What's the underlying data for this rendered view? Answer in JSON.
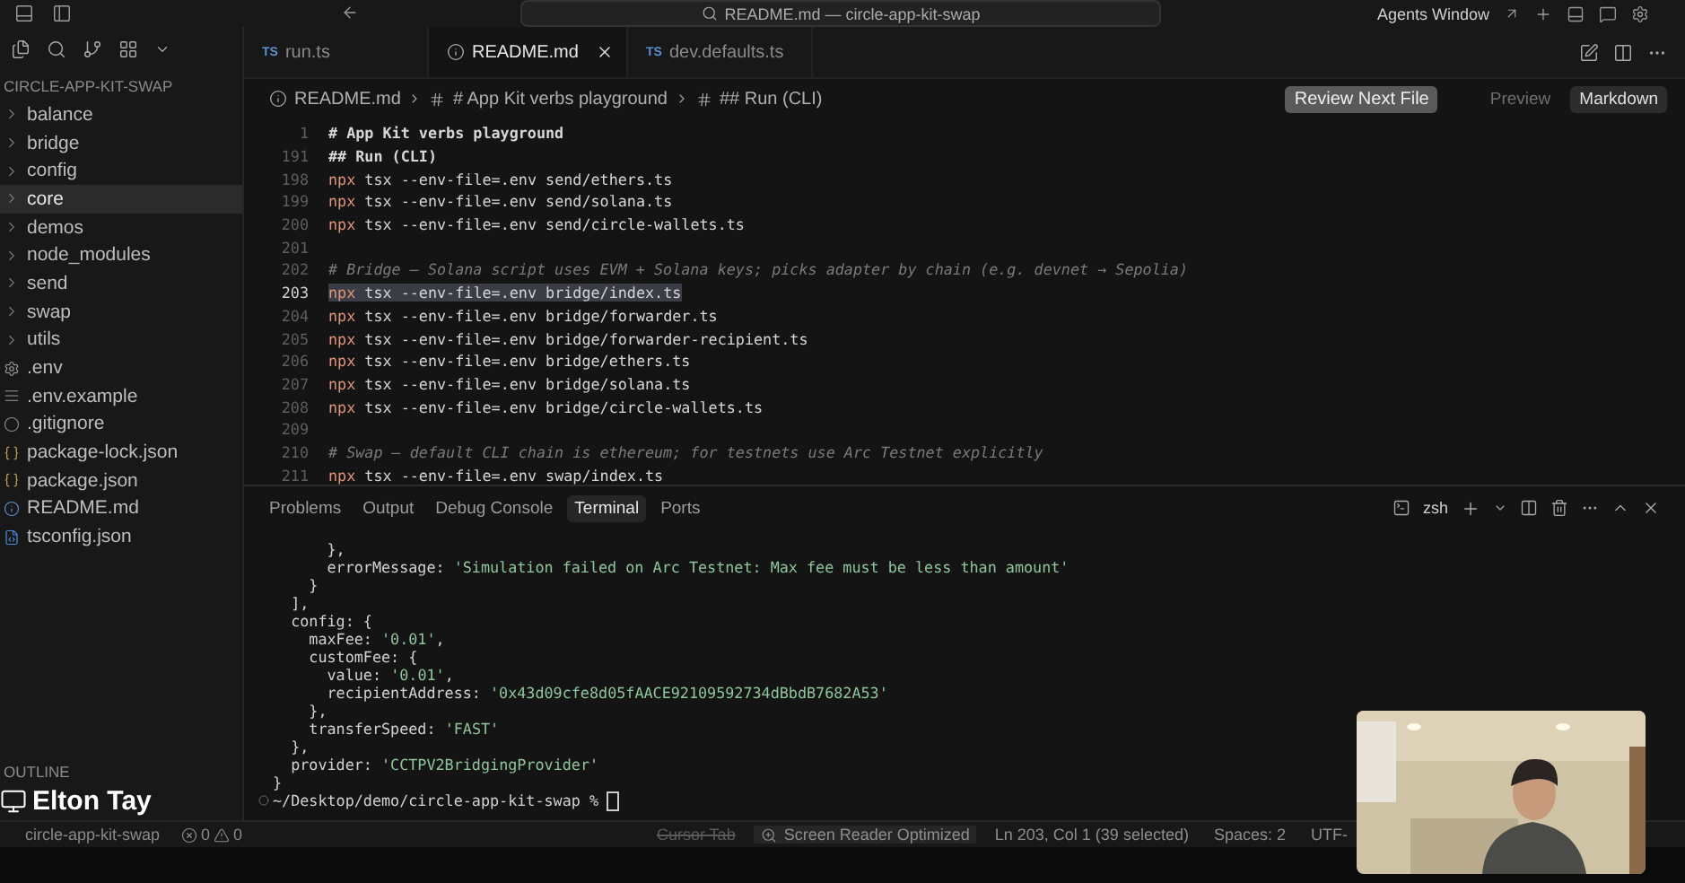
{
  "title_bar": {
    "command_center": "README.md — circle-app-kit-swap",
    "agents_window": "Agents Window"
  },
  "sidebar": {
    "title": "CIRCLE-APP-KIT-SWAP",
    "items": [
      {
        "label": "balance",
        "kind": "folder",
        "selected": false
      },
      {
        "label": "bridge",
        "kind": "folder",
        "selected": false
      },
      {
        "label": "config",
        "kind": "folder",
        "selected": false
      },
      {
        "label": "core",
        "kind": "folder",
        "selected": true
      },
      {
        "label": "demos",
        "kind": "folder",
        "selected": false
      },
      {
        "label": "node_modules",
        "kind": "folder",
        "selected": false
      },
      {
        "label": "send",
        "kind": "folder",
        "selected": false
      },
      {
        "label": "swap",
        "kind": "folder",
        "selected": false
      },
      {
        "label": "utils",
        "kind": "folder",
        "selected": false
      },
      {
        "label": ".env",
        "kind": "env",
        "selected": false
      },
      {
        "label": ".env.example",
        "kind": "text",
        "selected": false
      },
      {
        "label": ".gitignore",
        "kind": "git",
        "selected": false
      },
      {
        "label": "package-lock.json",
        "kind": "json",
        "selected": false
      },
      {
        "label": "package.json",
        "kind": "json",
        "selected": false
      },
      {
        "label": "README.md",
        "kind": "info",
        "selected": false
      },
      {
        "label": "tsconfig.json",
        "kind": "ts",
        "selected": false
      }
    ],
    "outline": "OUTLINE"
  },
  "editor_tabs": [
    {
      "label": "run.ts",
      "kind": "ts",
      "badge": "TS",
      "selected": false
    },
    {
      "label": "README.md",
      "kind": "markdown",
      "selected": true
    },
    {
      "label": "dev.defaults.ts",
      "kind": "ts",
      "badge": "TS",
      "selected": false
    }
  ],
  "breadcrumb": [
    "README.md",
    "# App Kit verbs playground",
    "## Run (CLI)"
  ],
  "review_button": "Review Next File",
  "view_modes": [
    {
      "label": "Preview",
      "selected": false
    },
    {
      "label": "Markdown",
      "selected": true
    }
  ],
  "code_lines": [
    {
      "number": "1",
      "kind": "heading",
      "code": "# App Kit verbs playground",
      "selected": false
    },
    {
      "number": "191",
      "kind": "heading",
      "code": "## Run (CLI)",
      "selected": false
    },
    {
      "number": "198",
      "kind": "command",
      "code": "npx tsx --env-file=.env send/ethers.ts",
      "selected": false
    },
    {
      "number": "199",
      "kind": "command",
      "code": "npx tsx --env-file=.env send/solana.ts",
      "selected": false
    },
    {
      "number": "200",
      "kind": "command",
      "code": "npx tsx --env-file=.env send/circle-wallets.ts",
      "selected": false
    },
    {
      "number": "201",
      "kind": "blank",
      "selected": false
    },
    {
      "number": "202",
      "kind": "comment",
      "code": "# Bridge — Solana script uses EVM + Solana keys; picks adapter by chain (e.g. devnet → Sepolia)",
      "selected": false
    },
    {
      "number": "203",
      "kind": "command",
      "code": "npx tsx --env-file=.env bridge/index.ts",
      "selected": true
    },
    {
      "number": "204",
      "kind": "command",
      "code": "npx tsx --env-file=.env bridge/forwarder.ts",
      "selected": false
    },
    {
      "number": "205",
      "kind": "command",
      "code": "npx tsx --env-file=.env bridge/forwarder-recipient.ts",
      "selected": false
    },
    {
      "number": "206",
      "kind": "command",
      "code": "npx tsx --env-file=.env bridge/ethers.ts",
      "selected": false
    },
    {
      "number": "207",
      "kind": "command",
      "code": "npx tsx --env-file=.env bridge/solana.ts",
      "selected": false
    },
    {
      "number": "208",
      "kind": "command",
      "code": "npx tsx --env-file=.env bridge/circle-wallets.ts",
      "selected": false
    },
    {
      "number": "209",
      "kind": "blank",
      "selected": false
    },
    {
      "number": "210",
      "kind": "comment",
      "code": "# Swap — default CLI chain is ethereum; for testnets use Arc Testnet explicitly",
      "selected": false
    },
    {
      "number": "211",
      "kind": "command",
      "code": "npx tsx --env-file=.env swap/index.ts",
      "selected": false
    }
  ],
  "panel_tabs": [
    {
      "label": "Problems",
      "selected": false
    },
    {
      "label": "Output",
      "selected": false
    },
    {
      "label": "Debug Console",
      "selected": false
    },
    {
      "label": "Terminal",
      "selected": true
    },
    {
      "label": "Ports",
      "selected": false
    }
  ],
  "terminal": {
    "shell": "zsh",
    "lines": [
      [
        {
          "kind": "plain",
          "text": "      },"
        }
      ],
      [
        {
          "kind": "plain",
          "text": "      errorMessage: "
        },
        {
          "kind": "string",
          "text": "'Simulation failed on Arc Testnet: Max fee must be less than amount'"
        }
      ],
      [
        {
          "kind": "plain",
          "text": "    }"
        }
      ],
      [
        {
          "kind": "plain",
          "text": "  ],"
        }
      ],
      [
        {
          "kind": "plain",
          "text": "  config: {"
        }
      ],
      [
        {
          "kind": "plain",
          "text": "    maxFee: "
        },
        {
          "kind": "string",
          "text": "'0.01'"
        },
        {
          "kind": "plain",
          "text": ","
        }
      ],
      [
        {
          "kind": "plain",
          "text": "    customFee: {"
        }
      ],
      [
        {
          "kind": "plain",
          "text": "      value: "
        },
        {
          "kind": "string",
          "text": "'0.01'"
        },
        {
          "kind": "plain",
          "text": ","
        }
      ],
      [
        {
          "kind": "plain",
          "text": "      recipientAddress: "
        },
        {
          "kind": "string",
          "text": "'0x43d09cfe8d05fAACE92109592734dBbdB7682A53'"
        }
      ],
      [
        {
          "kind": "plain",
          "text": "    },"
        }
      ],
      [
        {
          "kind": "plain",
          "text": "    transferSpeed: "
        },
        {
          "kind": "string",
          "text": "'FAST'"
        }
      ],
      [
        {
          "kind": "plain",
          "text": "  },"
        }
      ],
      [
        {
          "kind": "plain",
          "text": "  provider: "
        },
        {
          "kind": "string",
          "text": "'CCTPV2BridgingProvider'"
        }
      ],
      [
        {
          "kind": "plain",
          "text": "}"
        }
      ]
    ],
    "prompt": "~/Desktop/demo/circle-app-kit-swap %"
  },
  "status_bar": {
    "branch": "circle-app-kit-swap",
    "errors": "0",
    "warnings": "0",
    "right": [
      {
        "text": "Cursor Tab",
        "kind": "plain",
        "disabled": true
      },
      {
        "text": "Screen Reader Optimized",
        "kind": "accessibility",
        "disabled": false
      },
      {
        "text": "Ln 203, Col 1 (39 selected)",
        "kind": "plain",
        "disabled": false
      },
      {
        "text": "Spaces: 2",
        "kind": "plain",
        "disabled": false
      },
      {
        "text": "UTF-",
        "kind": "plain",
        "disabled": false
      }
    ]
  },
  "share_label": "Elton Tay"
}
